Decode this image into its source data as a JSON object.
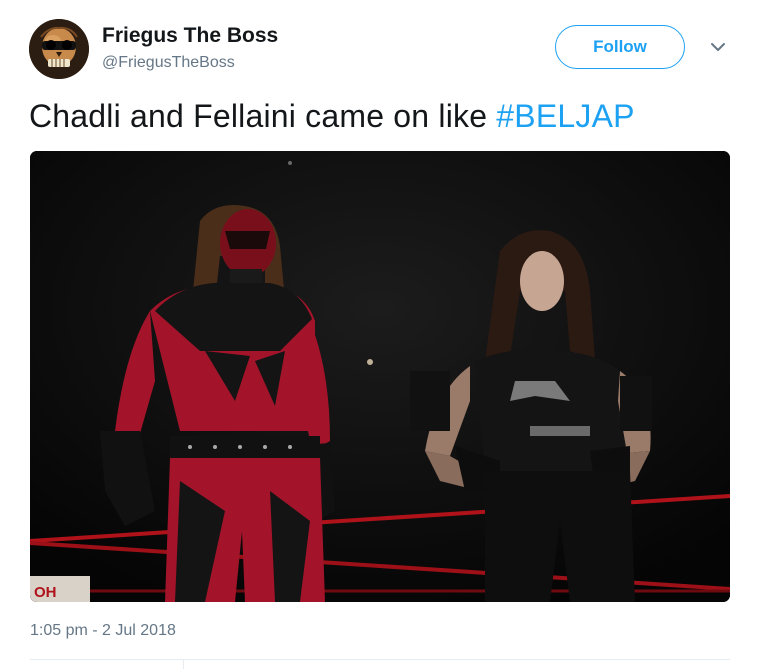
{
  "tweet": {
    "author": {
      "display_name": "Friegus The Boss",
      "handle": "@FriegusTheBoss",
      "avatar_icon": "skull-avatar-icon"
    },
    "follow_label": "Follow",
    "text_prefix": "Chadli and Fellaini came on like ",
    "hashtag": "#BELJAP",
    "media": {
      "sign_text": "OH"
    },
    "timestamp": "1:05 pm - 2 Jul 2018"
  },
  "colors": {
    "accent": "#1da1f2",
    "text": "#14171a",
    "secondary": "#657786"
  }
}
